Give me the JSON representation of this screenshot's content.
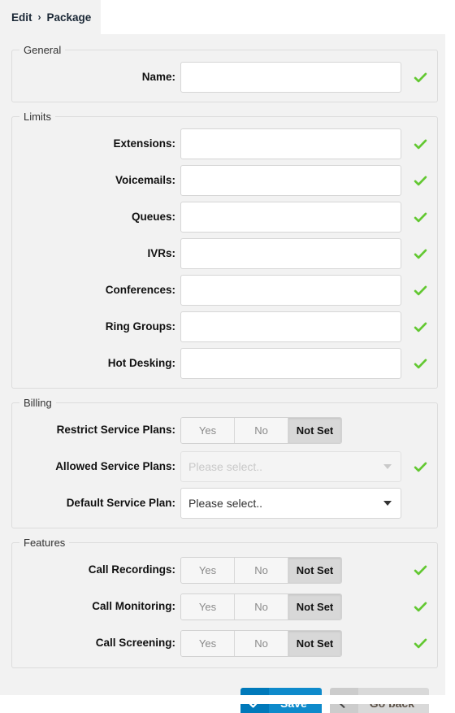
{
  "breadcrumb": {
    "root": "Edit",
    "separator": "›",
    "current": "Package"
  },
  "sections": {
    "general": {
      "legend": "General",
      "fields": [
        {
          "label": "Name:",
          "type": "text",
          "value": "",
          "placeholder": "",
          "valid": true
        }
      ]
    },
    "limits": {
      "legend": "Limits",
      "fields": [
        {
          "label": "Extensions:",
          "type": "text",
          "value": "",
          "placeholder": "",
          "valid": true
        },
        {
          "label": "Voicemails:",
          "type": "text",
          "value": "",
          "placeholder": "",
          "valid": true
        },
        {
          "label": "Queues:",
          "type": "text",
          "value": "",
          "placeholder": "",
          "valid": true
        },
        {
          "label": "IVRs:",
          "type": "text",
          "value": "",
          "placeholder": "",
          "valid": true
        },
        {
          "label": "Conferences:",
          "type": "text",
          "value": "",
          "placeholder": "",
          "valid": true
        },
        {
          "label": "Ring Groups:",
          "type": "text",
          "value": "",
          "placeholder": "",
          "valid": true
        },
        {
          "label": "Hot Desking:",
          "type": "text",
          "value": "",
          "placeholder": "",
          "valid": true
        }
      ]
    },
    "billing": {
      "legend": "Billing",
      "restrict_service_plans": {
        "label": "Restrict Service Plans:",
        "options": [
          "Yes",
          "No",
          "Not Set"
        ],
        "selected": "Not Set",
        "valid": false
      },
      "allowed_service_plans": {
        "label": "Allowed Service Plans:",
        "value": "Please select..",
        "disabled": true,
        "valid": true
      },
      "default_service_plan": {
        "label": "Default Service Plan:",
        "value": "Please select..",
        "disabled": false,
        "valid": false
      }
    },
    "features": {
      "legend": "Features",
      "toggles": [
        {
          "label": "Call Recordings:",
          "options": [
            "Yes",
            "No",
            "Not Set"
          ],
          "selected": "Not Set",
          "valid": true
        },
        {
          "label": "Call Monitoring:",
          "options": [
            "Yes",
            "No",
            "Not Set"
          ],
          "selected": "Not Set",
          "valid": true
        },
        {
          "label": "Call Screening:",
          "options": [
            "Yes",
            "No",
            "Not Set"
          ],
          "selected": "Not Set",
          "valid": true
        }
      ]
    }
  },
  "footer": {
    "save": {
      "label": "Save",
      "icon": "check-icon"
    },
    "go_back": {
      "label": "Go back",
      "icon": "arrow-left-icon"
    }
  },
  "colors": {
    "save_bg": "#0e8acb",
    "save_icon_bg": "#0079ba",
    "back_bg": "#d9d9d9",
    "back_icon_bg": "#cccccc",
    "valid_tick": "#63c832",
    "active_toggle_bg": "#d8d8d8",
    "canvas_bg": "#f2f2f2"
  }
}
